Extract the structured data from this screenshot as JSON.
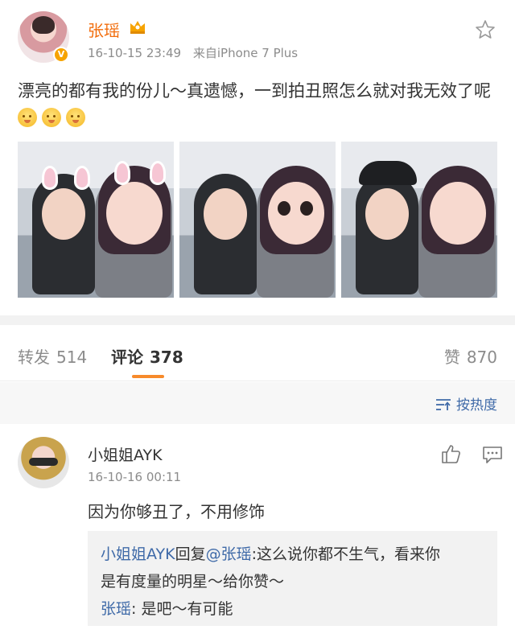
{
  "post": {
    "author": "张瑶",
    "timestamp": "16-10-15 23:49",
    "source": "来自iPhone 7 Plus",
    "text": "漂亮的都有我的份儿～真遗憾，一到拍丑照怎么就对我无效了呢",
    "emoji_count": 3,
    "verified_icon": "v-badge-icon",
    "member_icon": "crown-icon",
    "favorite_icon": "star-icon",
    "photo_count": 3
  },
  "tabs": {
    "repost_label": "转发",
    "repost_count": "514",
    "comment_label": "评论",
    "comment_count": "378",
    "like_label": "赞",
    "like_count": "870",
    "active_tab": "comments",
    "accent_color": "#f78a2b"
  },
  "sort": {
    "label": "按热度",
    "icon": "sort-icon",
    "color": "#3f6aa8"
  },
  "comment": {
    "user": "小姐姐AYK",
    "time": "16-10-16 00:11",
    "text": "因为你够丑了，不用修饰",
    "like_icon": "thumbs-up-icon",
    "reply_icon": "comment-icon",
    "replies": {
      "first_user": "小姐姐AYK",
      "reply_word": "回复",
      "mention": "@张瑶",
      "first_text_line1": ":这么说你都不生气，看来你",
      "first_text_line2": "是有度量的明星～给你赞～",
      "second_user": "张瑶",
      "second_text": ": 是吧～有可能"
    }
  }
}
